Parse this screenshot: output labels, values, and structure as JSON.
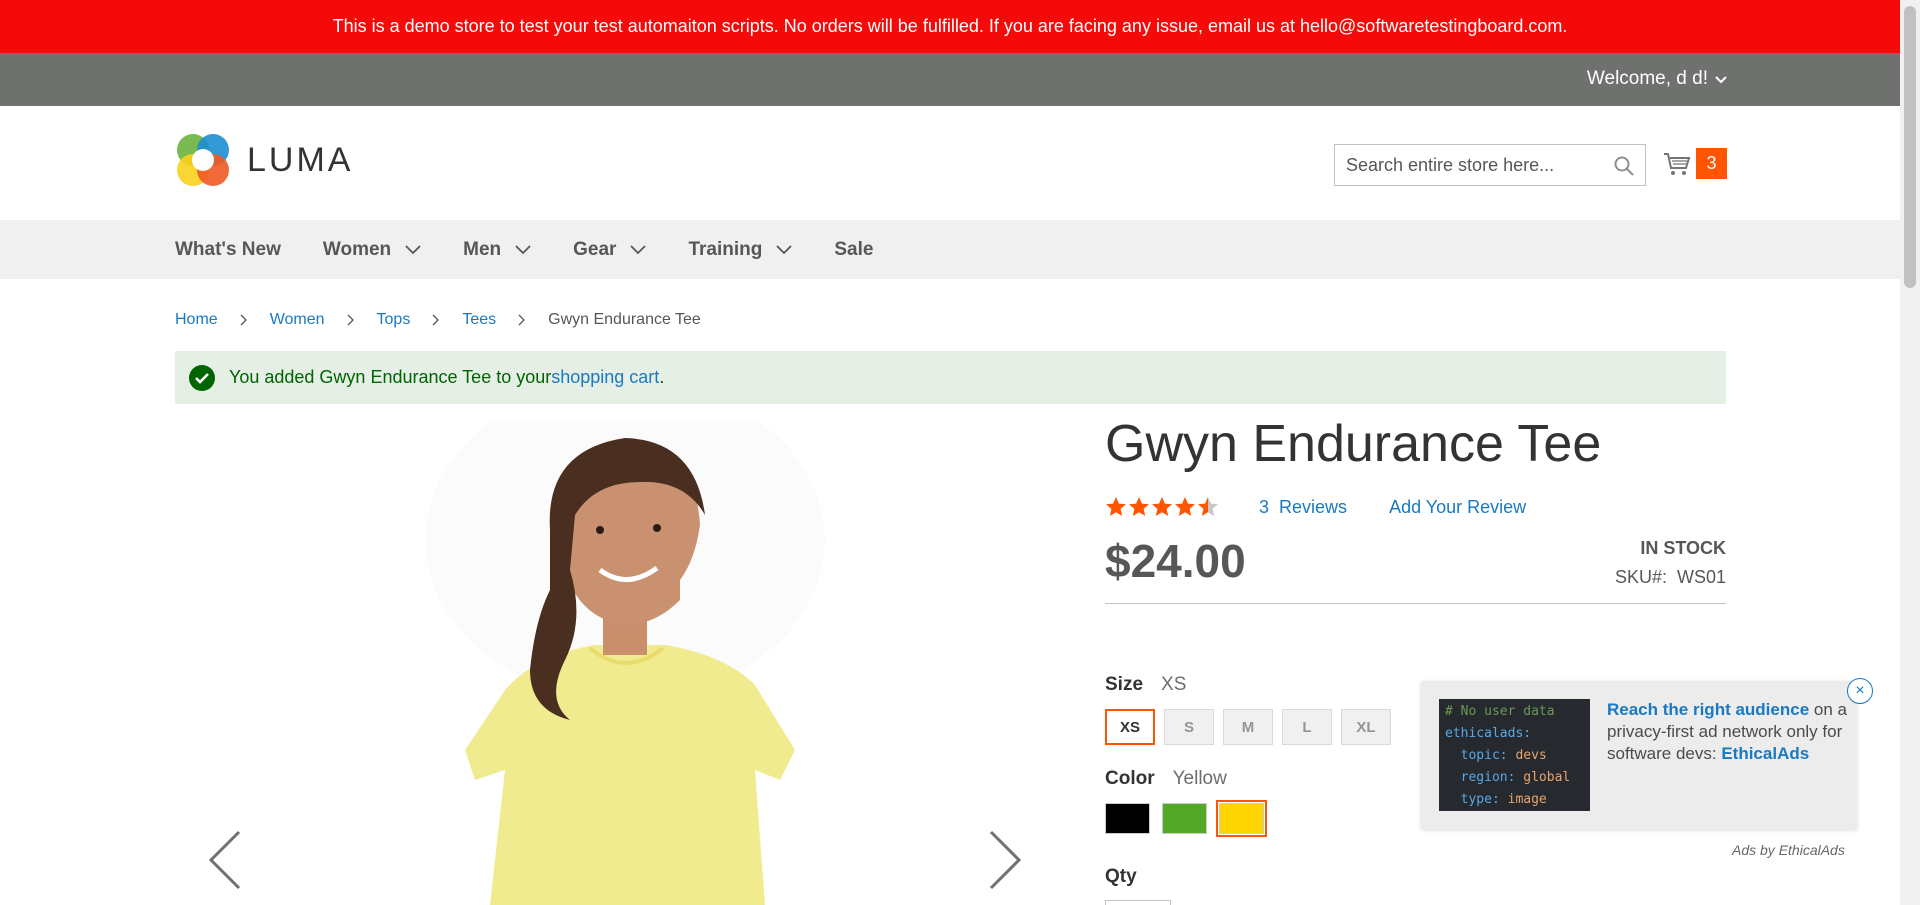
{
  "notice": "This is a demo store to test your test automaiton scripts. No orders will be fulfilled. If you are facing any issue, email us at hello@softwaretestingboard.com.",
  "account": {
    "welcome": "Welcome, d d!"
  },
  "header": {
    "logo_text": "LUMA",
    "search_placeholder": "Search entire store here...",
    "cart_count": "3"
  },
  "nav": {
    "items": [
      {
        "label": "What's New",
        "has_dropdown": false
      },
      {
        "label": "Women",
        "has_dropdown": true
      },
      {
        "label": "Men",
        "has_dropdown": true
      },
      {
        "label": "Gear",
        "has_dropdown": true
      },
      {
        "label": "Training",
        "has_dropdown": true
      },
      {
        "label": "Sale",
        "has_dropdown": false
      }
    ]
  },
  "breadcrumb": {
    "items": [
      "Home",
      "Women",
      "Tops",
      "Tees"
    ],
    "current": "Gwyn Endurance Tee"
  },
  "message": {
    "prefix": "You added Gwyn Endurance Tee to your ",
    "link": "shopping cart",
    "suffix": "."
  },
  "product": {
    "title": "Gwyn Endurance Tee",
    "rating_stars": 4.5,
    "reviews_count": "3",
    "reviews_label": "Reviews",
    "add_review": "Add Your Review",
    "price": "$24.00",
    "stock": "IN STOCK",
    "sku_label": "SKU#:",
    "sku": "WS01",
    "size_label": "Size",
    "size_selected": "XS",
    "sizes": [
      "XS",
      "S",
      "M",
      "L",
      "XL"
    ],
    "color_label": "Color",
    "color_selected": "Yellow",
    "colors": [
      {
        "name": "Black",
        "hex": "#000000"
      },
      {
        "name": "Green",
        "hex": "#53a828"
      },
      {
        "name": "Yellow",
        "hex": "#ffd500"
      }
    ],
    "qty_label": "Qty"
  },
  "ad": {
    "code_comment": "# No user data",
    "code_key": "ethicalads",
    "code_lines": [
      {
        "k": "topic",
        "v": "devs"
      },
      {
        "k": "region",
        "v": "global"
      },
      {
        "k": "type",
        "v": "image"
      }
    ],
    "headline": "Reach the right audience",
    "body": " on a privacy-first ad network only for software devs: ",
    "brand": "EthicalAds",
    "close": "×",
    "credit": "Ads by EthicalAds"
  },
  "colors": {
    "notice_bg": "#f50a0a",
    "account_bar_bg": "#6e716e",
    "accent": "#ff5501",
    "link": "#1979c3"
  }
}
